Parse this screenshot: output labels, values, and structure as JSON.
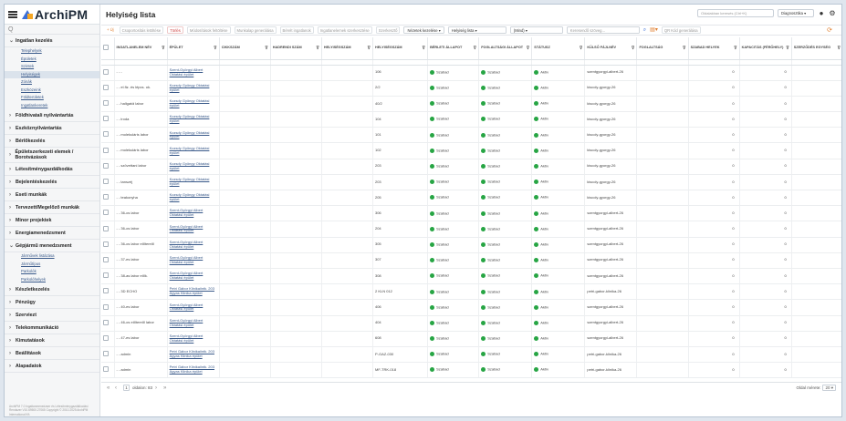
{
  "app": {
    "name": "ArchiPM",
    "page_title": "Helyiség lista"
  },
  "top": {
    "search_placeholder": "Oldalakban keresés (Ctrl+K)",
    "diagnostics": "Diagnosztika"
  },
  "sidebar": {
    "search": "Q",
    "sections": [
      {
        "label": "Ingatlan kezelés",
        "open": true,
        "items": [
          "Telephelyek",
          "Épületek",
          "Szintek",
          "Helyiségek",
          "Zónák",
          "Eszközeink",
          "Földterületek",
          "Ingatlankeretek"
        ],
        "active": "Helyiségek"
      },
      {
        "label": "Földhivatali nyilvántartás",
        "open": false
      },
      {
        "label": "Eszköznyilvántartás",
        "open": false
      },
      {
        "label": "Bérlőkezelés",
        "open": false
      },
      {
        "label": "Épületszerkezeti elemek / Borotvázások",
        "open": false,
        "tall": true
      },
      {
        "label": "Létesítménygazdálkodás",
        "open": false
      },
      {
        "label": "Bejelentéskezelés",
        "open": false
      },
      {
        "label": "Eseti munkák",
        "open": false
      },
      {
        "label": "Tervezett/Megelőző munkák",
        "open": false
      },
      {
        "label": "Minor projektek",
        "open": false
      },
      {
        "label": "Energiamenedzsment",
        "open": false
      },
      {
        "label": "Gépjármű menedzsment",
        "open": true,
        "items": [
          "Járművek listázása",
          "Járműtípus",
          "Parkolók",
          "Parkolóhelyek"
        ]
      },
      {
        "label": "Készletkezelés",
        "open": false
      },
      {
        "label": "Pénzügy",
        "open": false
      },
      {
        "label": "Szerviezt",
        "open": false
      },
      {
        "label": "Telekommunikáció",
        "open": false
      },
      {
        "label": "Kimutatások",
        "open": false
      },
      {
        "label": "Beállítások",
        "open": false
      },
      {
        "label": "Alapadatok",
        "open": false
      }
    ],
    "footer": "ArchiPM 7.0 Ingatlanmenedzser és Létesítménygazdálkodási Rendszer V10.69500.27065 Copyright © 2010-2025 ArchiPM International Kft."
  },
  "toolbar": {
    "add": "Új",
    "copy": "Csoportosítás letöltése",
    "delete": "Törlés",
    "bulk": "Módosítások feltöltése",
    "worksheet": "Munkalap generálása",
    "lease": "Bérelt ingatlanok",
    "export": "Ingatlanelemek szerkesztése",
    "jump": "Szerkesztő",
    "view_select": "Nézetek kezelése",
    "list_select": "Helyiség lista",
    "filter_select": "(Mind)",
    "search_placeholder": "Keresendő szöveg...",
    "qr": "QR Kód generálása"
  },
  "table": {
    "columns": [
      "Ingatlanelem név",
      "Épület",
      "Cikkszám",
      "Hadrendi szám",
      "Helyiségszám",
      "Helyiségszám",
      "Bérleti állapot",
      "Foglaltsági állapot",
      "Státusz",
      "Külső fájlnév",
      "Foglaltság",
      "Szabad helyek",
      "Kapacitás (férőhely)",
      "Szerződés egység"
    ],
    "rows": [
      {
        "name": "- - -",
        "building": "Szent-Györgyi Albert Oktatási épület",
        "room": "106",
        "lease": "Szabad",
        "occ": "Szabad",
        "status": "Aktív",
        "file": "szentgyorgyi-albert-26",
        "free": "0",
        "cap": "0"
      },
      {
        "name": "- - el.fiz. és lépcs. ok.",
        "building": "Kozsdy Gyöngy Oktatási épület",
        "room": "2/2",
        "lease": "Szabad",
        "occ": "Szabad",
        "status": "Aktív",
        "file": "kiscoly-gyorgy-26",
        "free": "0",
        "cap": "0"
      },
      {
        "name": "- - hallgatói labor",
        "building": "Kozsdy Gyöngy Oktatási épület",
        "room": "40/2",
        "lease": "Szabad",
        "occ": "Szabad",
        "status": "Aktív",
        "file": "kiscoly-gyorgy-26",
        "free": "0",
        "cap": "0"
      },
      {
        "name": "- - iroda",
        "building": "Kozsdy Gyöngy Oktatási épület",
        "room": "104",
        "lease": "Szabad",
        "occ": "Szabad",
        "status": "Aktív",
        "file": "kiscoly-gyorgy-26",
        "free": "0",
        "cap": "0"
      },
      {
        "name": "- - molekuláris labor",
        "building": "Kozsdy Gyöngy Oktatási épület",
        "room": "101",
        "lease": "Szabad",
        "occ": "Szabad",
        "status": "Aktív",
        "file": "kiscoly-gyorgy-26",
        "free": "0",
        "cap": "0"
      },
      {
        "name": "- - molekuláris labor",
        "building": "Kozsdy Gyöngy Oktatási épület",
        "room": "102",
        "lease": "Szabad",
        "occ": "Szabad",
        "status": "Aktív",
        "file": "kiscoly-gyorgy-26",
        "free": "0",
        "cap": "0"
      },
      {
        "name": "- - szövettani labor",
        "building": "Kozsdy Gyöngy Oktatási épület",
        "room": "203",
        "lease": "Szabad",
        "occ": "Szabad",
        "status": "Aktív",
        "file": "kiscoly-gyorgy-26",
        "free": "0",
        "cap": "0"
      },
      {
        "name": "- - tanszéj",
        "building": "Kozsdy Gyöngy Oktatási épület",
        "room": "203",
        "lease": "Szabad",
        "occ": "Szabad",
        "status": "Aktív",
        "file": "kiscoly-gyorgy-26",
        "free": "0",
        "cap": "0"
      },
      {
        "name": "- - teakonyha",
        "building": "Kozsdy Gyöngy Oktatási épület",
        "room": "205",
        "lease": "Szabad",
        "occ": "Szabad",
        "status": "Aktív",
        "file": "kiscoly-gyorgy-26",
        "free": "0",
        "cap": "0"
      },
      {
        "name": "- - 36-os labor",
        "building": "Szent-Györgyi Albert Oktatási épület",
        "room": "306",
        "lease": "Szabad",
        "occ": "Szabad",
        "status": "Aktív",
        "file": "szentgyorgyi-albert-26",
        "free": "0",
        "cap": "0"
      },
      {
        "name": "- - 36-os labor",
        "building": "Szent-Györgyi Albert Oktatási épület",
        "room": "204",
        "lease": "Szabad",
        "occ": "Szabad",
        "status": "Aktív",
        "file": "szentgyorgyi-albert-26",
        "free": "0",
        "cap": "0"
      },
      {
        "name": "- - 36-os labor előterelő",
        "building": "Szent-Györgyi Albert Oktatási épület",
        "room": "305",
        "lease": "Szabad",
        "occ": "Szabad",
        "status": "Aktív",
        "file": "szentgyorgyi-albert-26",
        "free": "0",
        "cap": "0"
      },
      {
        "name": "- - 37-es labor",
        "building": "Szent-Györgyi Albert Oktatási épület",
        "room": "307",
        "lease": "Szabad",
        "occ": "Szabad",
        "status": "Aktív",
        "file": "szentgyorgyi-albert-26",
        "free": "0",
        "cap": "0"
      },
      {
        "name": "- - 38-as labor elők.",
        "building": "Szent-Györgyi Albert Oktatási épület",
        "room": "308",
        "lease": "Szabad",
        "occ": "Szabad",
        "status": "Aktív",
        "file": "szentgyorgyi-albert-26",
        "free": "0",
        "cap": "0"
      },
      {
        "name": "- - 3D ECHO",
        "building": "Petri Gábor Klinikaiintk. 203 Ágyas Klinika épület",
        "room": "2 KLN 012",
        "lease": "Szabad",
        "occ": "Szabad",
        "status": "Aktív",
        "file": "petri-gabor-klinika-26",
        "free": "0",
        "cap": "0"
      },
      {
        "name": "- - 40-es labor",
        "building": "Szent-Györgyi Albert Oktatási épület",
        "room": "406",
        "lease": "Szabad",
        "occ": "Szabad",
        "status": "Aktív",
        "file": "szentgyorgyi-albert-26",
        "free": "0",
        "cap": "0"
      },
      {
        "name": "- - 46-os előterelő labor",
        "building": "Szent-Györgyi Albert Oktatási épület",
        "room": "404",
        "lease": "Szabad",
        "occ": "Szabad",
        "status": "Aktív",
        "file": "szentgyorgyi-albert-26",
        "free": "0",
        "cap": "0"
      },
      {
        "name": "- - 47-es labor",
        "building": "Szent-Györgyi Albert Oktatási épület",
        "room": "608",
        "lease": "Szabad",
        "occ": "Szabad",
        "status": "Aktív",
        "file": "szentgyorgyi-albert-26",
        "free": "0",
        "cap": "0"
      },
      {
        "name": "- - admin",
        "building": "Petri Gábor Klinikaiintk. 203 Ágyas Klinika épület",
        "room": "P-GAZ-030",
        "lease": "Szabad",
        "occ": "Szabad",
        "status": "Aktív",
        "file": "petri-gabor-klinika-26",
        "free": "0",
        "cap": "0"
      },
      {
        "name": "- - admin",
        "building": "Petri Gábor Klinikaiintk. 203 Ágyas Klinika épület",
        "room": "MF-TRK-018",
        "lease": "Szabad",
        "occ": "Szabad",
        "status": "Aktív",
        "file": "petri-gabor-klinika-26",
        "free": "0",
        "cap": "0"
      }
    ]
  },
  "pager": {
    "page": "1",
    "of_label": "oldalon: 83",
    "total_label": "Oldal mérete:",
    "page_size": "20"
  },
  "colors": {
    "accent": "#e07b2a",
    "status_green": "#27a544",
    "brand_blue": "#3a6fd8"
  }
}
